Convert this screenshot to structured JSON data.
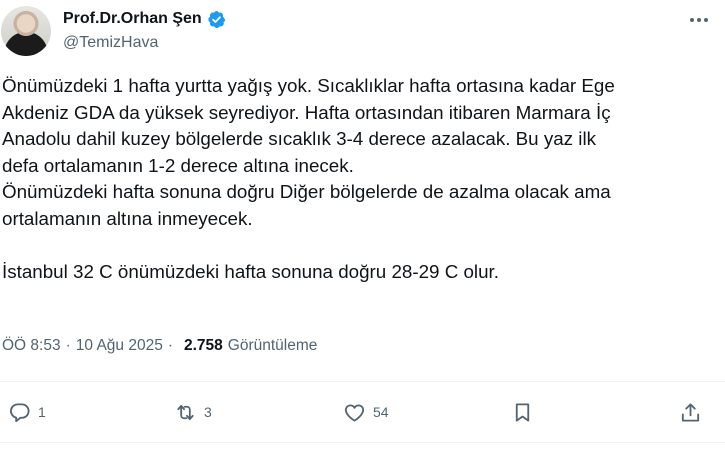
{
  "author": {
    "display_name": "Prof.Dr.Orhan Şen",
    "handle": "@TemizHava",
    "verified": true
  },
  "tweet": {
    "text": "Önümüzdeki 1 hafta yurtta yağış yok. Sıcaklıklar hafta ortasına kadar Ege\nAkdeniz GDA da yüksek seyrediyor. Hafta ortasından itibaren Marmara İç\nAnadolu dahil kuzey bölgelerde sıcaklık 3-4 derece azalacak. Bu yaz ilk\ndefa ortalamanın 1-2 derece altına inecek.\nÖnümüzdeki hafta sonuna doğru Diğer bölgelerde de azalma olacak ama\nortalamanın altına inmeyecek.\n\nİstanbul 32 C önümüzdeki hafta sonuna doğru 28-29 C olur."
  },
  "meta": {
    "time": "ÖÖ 8:53",
    "separator": "·",
    "date": "10 Ağu 2025",
    "views_count": "2.758",
    "views_label": "Görüntüleme"
  },
  "actions": {
    "reply_count": "1",
    "retweet_count": "3",
    "like_count": "54"
  },
  "icons": {
    "verified": "verified-badge-icon",
    "more": "more-icon",
    "reply": "reply-icon",
    "retweet": "retweet-icon",
    "like": "heart-icon",
    "bookmark": "bookmark-icon",
    "share": "share-icon"
  },
  "colors": {
    "text": "#0f1419",
    "secondary": "#536471",
    "verified": "#1d9bf0",
    "divider": "#eff3f4"
  }
}
